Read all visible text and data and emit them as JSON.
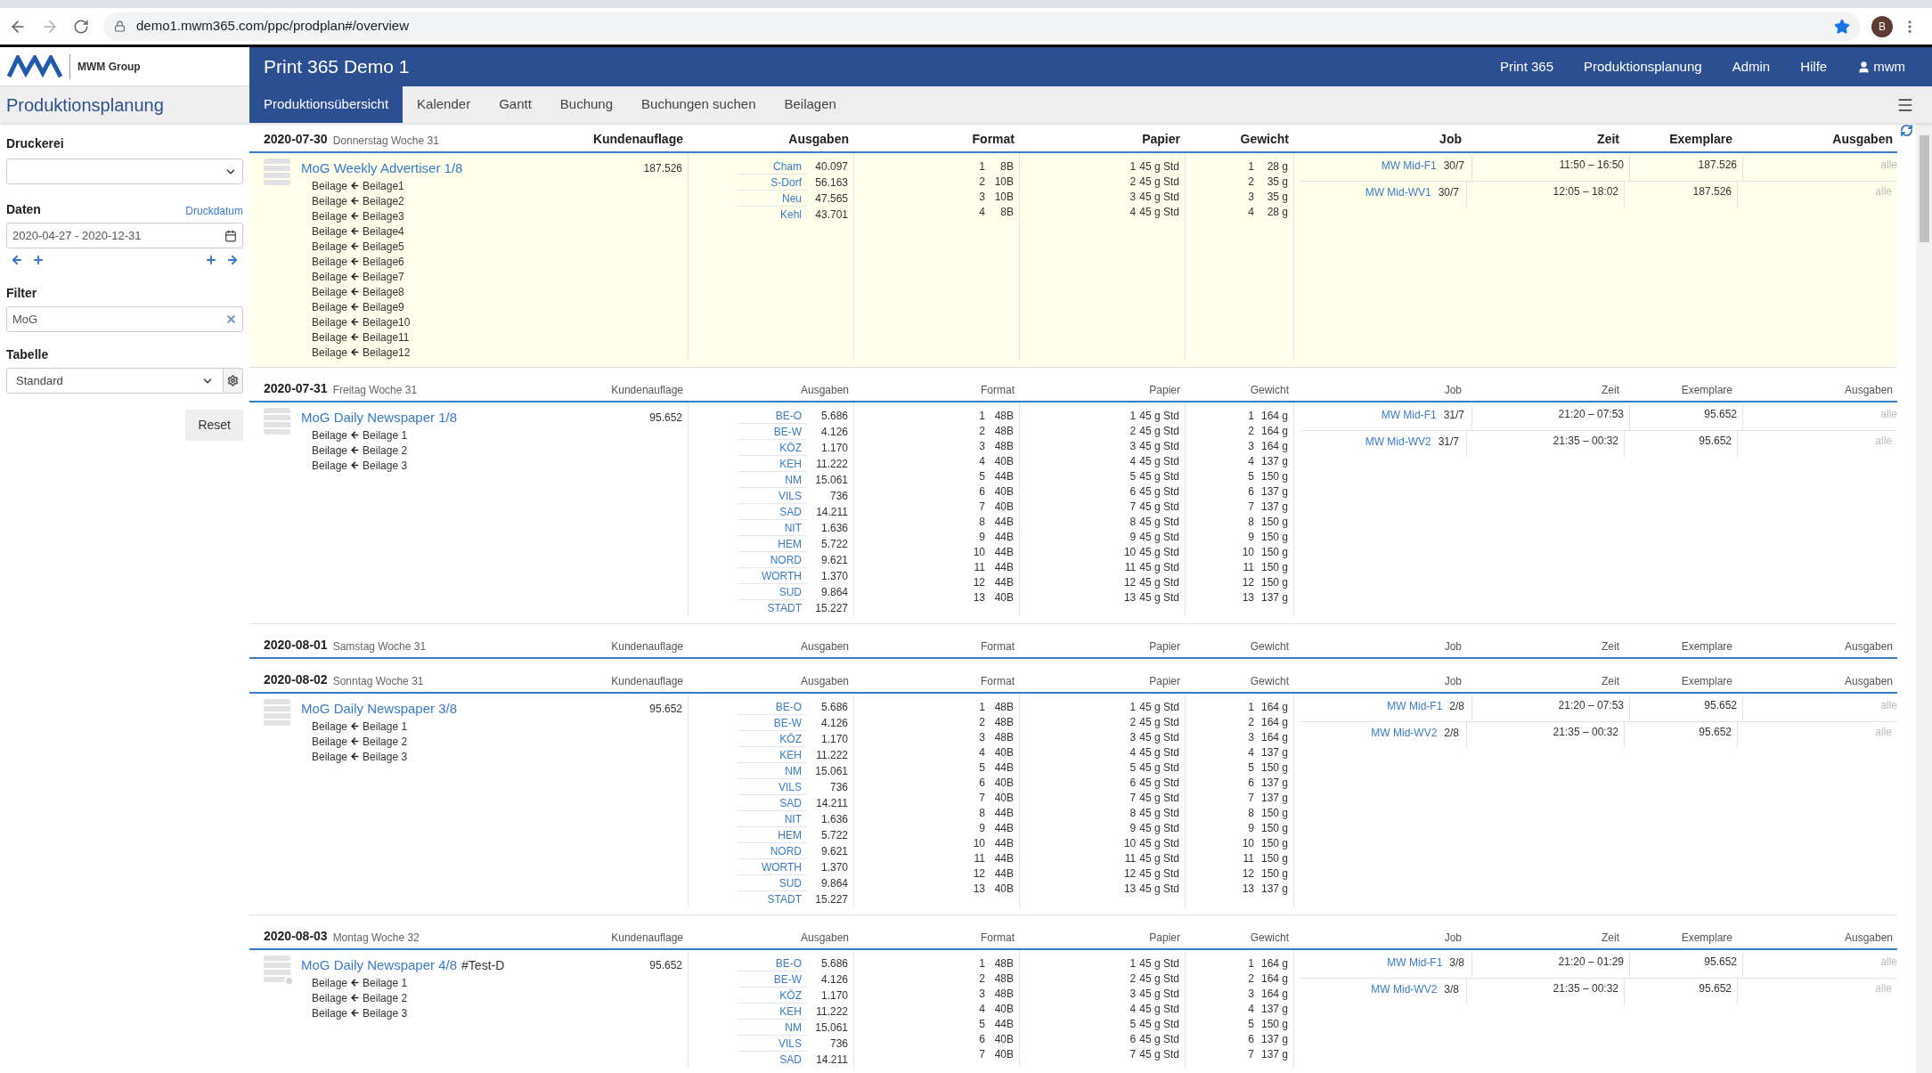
{
  "browser": {
    "url": "demo1.mwm365.com/ppc/prodplan#/overview",
    "profile": "B"
  },
  "brand": {
    "logo_text": "MWM Group",
    "app_name": "Produktionsplanung"
  },
  "header": {
    "title": "Print 365 Demo 1",
    "menu": [
      {
        "label": "Print 365",
        "kind": "link"
      },
      {
        "label": "Produktionsplanung",
        "kind": "link"
      },
      {
        "label": "Admin",
        "kind": "link"
      },
      {
        "label": "Hilfe",
        "kind": "link"
      },
      {
        "label": "mwm",
        "kind": "user"
      }
    ]
  },
  "tabs": [
    {
      "label": "Produktionsübersicht",
      "selected": true
    },
    {
      "label": "Kalender",
      "selected": false
    },
    {
      "label": "Gantt",
      "selected": false
    },
    {
      "label": "Buchung",
      "selected": false
    },
    {
      "label": "Buchungen suchen",
      "selected": false
    },
    {
      "label": "Beilagen",
      "selected": false
    }
  ],
  "sidebar": {
    "druckerei": {
      "label": "Druckerei"
    },
    "daten": {
      "label": "Daten",
      "link": "Druckdatum",
      "value": "2020-04-27 - 2020-12-31"
    },
    "filter": {
      "label": "Filter",
      "value": "MoG"
    },
    "tabelle": {
      "label": "Tabelle",
      "value": "Standard"
    },
    "reset": "Reset"
  },
  "days": [
    {
      "date": "2020-07-30",
      "weekday": "Donnerstag Woche 31",
      "highlighted": true,
      "columns": [
        "Kundenauflage",
        "Ausgaben",
        "Format",
        "Papier",
        "Gewicht",
        "Job",
        "Zeit",
        "Exemplare",
        "Ausgaben"
      ],
      "productions": [
        {
          "title": "MoG Weekly Advertiser 1/8",
          "marked": false,
          "circulation": "187.526",
          "inserts": [
            [
              "Beilage",
              "Beilage1"
            ],
            [
              "Beilage",
              "Beilage2"
            ],
            [
              "Beilage",
              "Beilage3"
            ],
            [
              "Beilage",
              "Beilage4"
            ],
            [
              "Beilage",
              "Beilage5"
            ],
            [
              "Beilage",
              "Beilage6"
            ],
            [
              "Beilage",
              "Beilage7"
            ],
            [
              "Beilage",
              "Beilage8"
            ],
            [
              "Beilage",
              "Beilage9"
            ],
            [
              "Beilage",
              "Beilage10"
            ],
            [
              "Beilage",
              "Beilage11"
            ],
            [
              "Beilage",
              "Beilage12"
            ]
          ],
          "editions": [
            [
              "Cham",
              "40.097"
            ],
            [
              "S-Dorf",
              "56.163"
            ],
            [
              "Neu",
              "47.565"
            ],
            [
              "Kehl",
              "43.701"
            ]
          ],
          "formats": [
            [
              "1",
              "8B"
            ],
            [
              "2",
              "10B"
            ],
            [
              "3",
              "10B"
            ],
            [
              "4",
              "8B"
            ]
          ],
          "papers": [
            [
              "1",
              "45 g Std"
            ],
            [
              "2",
              "45 g Std"
            ],
            [
              "3",
              "45 g Std"
            ],
            [
              "4",
              "45 g Std"
            ]
          ],
          "weights": [
            [
              "1",
              "28 g"
            ],
            [
              "2",
              "35 g"
            ],
            [
              "3",
              "35 g"
            ],
            [
              "4",
              "28 g"
            ]
          ],
          "jobs": [
            {
              "name": "MW Mid-F1",
              "date": "30/7",
              "time": "11:50 – 16:50",
              "copies": "187.526",
              "editions": "alle"
            },
            {
              "name": "MW Mid-WV1",
              "date": "30/7",
              "time": "12:05 – 18:02",
              "copies": "187.526",
              "editions": "alle"
            }
          ]
        }
      ]
    },
    {
      "date": "2020-07-31",
      "weekday": "Freitag Woche 31",
      "highlighted": false,
      "columns": [
        "Kundenauflage",
        "Ausgaben",
        "Format",
        "Papier",
        "Gewicht",
        "Job",
        "Zeit",
        "Exemplare",
        "Ausgaben"
      ],
      "productions": [
        {
          "title": "MoG Daily Newspaper 1/8",
          "marked": false,
          "circulation": "95.652",
          "inserts": [
            [
              "Beilage",
              "Beilage 1"
            ],
            [
              "Beilage",
              "Beilage 2"
            ],
            [
              "Beilage",
              "Beilage 3"
            ]
          ],
          "editions": [
            [
              "BE-O",
              "5.686"
            ],
            [
              "BE-W",
              "4.126"
            ],
            [
              "KÖZ",
              "1.170"
            ],
            [
              "KEH",
              "11.222"
            ],
            [
              "NM",
              "15.061"
            ],
            [
              "VILS",
              "736"
            ],
            [
              "SAD",
              "14.211"
            ],
            [
              "NIT",
              "1.636"
            ],
            [
              "HEM",
              "5.722"
            ],
            [
              "NORD",
              "9.621"
            ],
            [
              "WORTH",
              "1.370"
            ],
            [
              "SUD",
              "9.864"
            ],
            [
              "STADT",
              "15.227"
            ]
          ],
          "formats": [
            [
              "1",
              "48B"
            ],
            [
              "2",
              "48B"
            ],
            [
              "3",
              "48B"
            ],
            [
              "4",
              "40B"
            ],
            [
              "5",
              "44B"
            ],
            [
              "6",
              "40B"
            ],
            [
              "7",
              "40B"
            ],
            [
              "8",
              "44B"
            ],
            [
              "9",
              "44B"
            ],
            [
              "10",
              "44B"
            ],
            [
              "11",
              "44B"
            ],
            [
              "12",
              "44B"
            ],
            [
              "13",
              "40B"
            ]
          ],
          "papers": [
            [
              "1",
              "45 g Std"
            ],
            [
              "2",
              "45 g Std"
            ],
            [
              "3",
              "45 g Std"
            ],
            [
              "4",
              "45 g Std"
            ],
            [
              "5",
              "45 g Std"
            ],
            [
              "6",
              "45 g Std"
            ],
            [
              "7",
              "45 g Std"
            ],
            [
              "8",
              "45 g Std"
            ],
            [
              "9",
              "45 g Std"
            ],
            [
              "10",
              "45 g Std"
            ],
            [
              "11",
              "45 g Std"
            ],
            [
              "12",
              "45 g Std"
            ],
            [
              "13",
              "45 g Std"
            ]
          ],
          "weights": [
            [
              "1",
              "164 g"
            ],
            [
              "2",
              "164 g"
            ],
            [
              "3",
              "164 g"
            ],
            [
              "4",
              "137 g"
            ],
            [
              "5",
              "150 g"
            ],
            [
              "6",
              "137 g"
            ],
            [
              "7",
              "137 g"
            ],
            [
              "8",
              "150 g"
            ],
            [
              "9",
              "150 g"
            ],
            [
              "10",
              "150 g"
            ],
            [
              "11",
              "150 g"
            ],
            [
              "12",
              "150 g"
            ],
            [
              "13",
              "137 g"
            ]
          ],
          "jobs": [
            {
              "name": "MW Mid-F1",
              "date": "31/7",
              "time": "21:20 – 07:53",
              "copies": "95.652",
              "editions": "alle"
            },
            {
              "name": "MW Mid-WV2",
              "date": "31/7",
              "time": "21:35 – 00:32",
              "copies": "95.652",
              "editions": "alle"
            }
          ]
        }
      ]
    },
    {
      "date": "2020-08-01",
      "weekday": "Samstag Woche 31",
      "highlighted": false,
      "columns": [
        "Kundenauflage",
        "Ausgaben",
        "Format",
        "Papier",
        "Gewicht",
        "Job",
        "Zeit",
        "Exemplare",
        "Ausgaben"
      ]
    },
    {
      "date": "2020-08-02",
      "weekday": "Sonntag Woche 31",
      "highlighted": false,
      "columns": [
        "Kundenauflage",
        "Ausgaben",
        "Format",
        "Papier",
        "Gewicht",
        "Job",
        "Zeit",
        "Exemplare",
        "Ausgaben"
      ],
      "productions": [
        {
          "title": "MoG Daily Newspaper 3/8",
          "marked": false,
          "circulation": "95.652",
          "inserts": [
            [
              "Beilage",
              "Beilage 1"
            ],
            [
              "Beilage",
              "Beilage 2"
            ],
            [
              "Beilage",
              "Beilage 3"
            ]
          ],
          "editions": [
            [
              "BE-O",
              "5.686"
            ],
            [
              "BE-W",
              "4.126"
            ],
            [
              "KÖZ",
              "1.170"
            ],
            [
              "KEH",
              "11.222"
            ],
            [
              "NM",
              "15.061"
            ],
            [
              "VILS",
              "736"
            ],
            [
              "SAD",
              "14.211"
            ],
            [
              "NIT",
              "1.636"
            ],
            [
              "HEM",
              "5.722"
            ],
            [
              "NORD",
              "9.621"
            ],
            [
              "WORTH",
              "1.370"
            ],
            [
              "SUD",
              "9.864"
            ],
            [
              "STADT",
              "15.227"
            ]
          ],
          "formats": [
            [
              "1",
              "48B"
            ],
            [
              "2",
              "48B"
            ],
            [
              "3",
              "48B"
            ],
            [
              "4",
              "40B"
            ],
            [
              "5",
              "44B"
            ],
            [
              "6",
              "40B"
            ],
            [
              "7",
              "40B"
            ],
            [
              "8",
              "44B"
            ],
            [
              "9",
              "44B"
            ],
            [
              "10",
              "44B"
            ],
            [
              "11",
              "44B"
            ],
            [
              "12",
              "44B"
            ],
            [
              "13",
              "40B"
            ]
          ],
          "papers": [
            [
              "1",
              "45 g Std"
            ],
            [
              "2",
              "45 g Std"
            ],
            [
              "3",
              "45 g Std"
            ],
            [
              "4",
              "45 g Std"
            ],
            [
              "5",
              "45 g Std"
            ],
            [
              "6",
              "45 g Std"
            ],
            [
              "7",
              "45 g Std"
            ],
            [
              "8",
              "45 g Std"
            ],
            [
              "9",
              "45 g Std"
            ],
            [
              "10",
              "45 g Std"
            ],
            [
              "11",
              "45 g Std"
            ],
            [
              "12",
              "45 g Std"
            ],
            [
              "13",
              "45 g Std"
            ]
          ],
          "weights": [
            [
              "1",
              "164 g"
            ],
            [
              "2",
              "164 g"
            ],
            [
              "3",
              "164 g"
            ],
            [
              "4",
              "137 g"
            ],
            [
              "5",
              "150 g"
            ],
            [
              "6",
              "137 g"
            ],
            [
              "7",
              "137 g"
            ],
            [
              "8",
              "150 g"
            ],
            [
              "9",
              "150 g"
            ],
            [
              "10",
              "150 g"
            ],
            [
              "11",
              "150 g"
            ],
            [
              "12",
              "150 g"
            ],
            [
              "13",
              "137 g"
            ]
          ],
          "jobs": [
            {
              "name": "MW Mid-F1",
              "date": "2/8",
              "time": "21:20 – 07:53",
              "copies": "95.652",
              "editions": "alle"
            },
            {
              "name": "MW Mid-WV2",
              "date": "2/8",
              "time": "21:35 – 00:32",
              "copies": "95.652",
              "editions": "alle"
            }
          ]
        }
      ]
    },
    {
      "date": "2020-08-03",
      "weekday": "Montag Woche 32",
      "highlighted": false,
      "columns": [
        "Kundenauflage",
        "Ausgaben",
        "Format",
        "Papier",
        "Gewicht",
        "Job",
        "Zeit",
        "Exemplare",
        "Ausgaben"
      ],
      "productions": [
        {
          "title": "MoG Daily Newspaper 4/8",
          "tag": "#Test-D",
          "marked": true,
          "circulation": "95.652",
          "inserts": [
            [
              "Beilage",
              "Beilage 1"
            ],
            [
              "Beilage",
              "Beilage 2"
            ],
            [
              "Beilage",
              "Beilage 3"
            ]
          ],
          "editions": [
            [
              "BE-O",
              "5.686"
            ],
            [
              "BE-W",
              "4.126"
            ],
            [
              "KÖZ",
              "1.170"
            ],
            [
              "KEH",
              "11.222"
            ],
            [
              "NM",
              "15.061"
            ],
            [
              "VILS",
              "736"
            ],
            [
              "SAD",
              "14.211"
            ]
          ],
          "formats": [
            [
              "1",
              "48B"
            ],
            [
              "2",
              "48B"
            ],
            [
              "3",
              "48B"
            ],
            [
              "4",
              "40B"
            ],
            [
              "5",
              "44B"
            ],
            [
              "6",
              "40B"
            ],
            [
              "7",
              "40B"
            ]
          ],
          "papers": [
            [
              "1",
              "45 g Std"
            ],
            [
              "2",
              "45 g Std"
            ],
            [
              "3",
              "45 g Std"
            ],
            [
              "4",
              "45 g Std"
            ],
            [
              "5",
              "45 g Std"
            ],
            [
              "6",
              "45 g Std"
            ],
            [
              "7",
              "45 g Std"
            ]
          ],
          "weights": [
            [
              "1",
              "164 g"
            ],
            [
              "2",
              "164 g"
            ],
            [
              "3",
              "164 g"
            ],
            [
              "4",
              "137 g"
            ],
            [
              "5",
              "150 g"
            ],
            [
              "6",
              "137 g"
            ],
            [
              "7",
              "137 g"
            ]
          ],
          "jobs": [
            {
              "name": "MW Mid-F1",
              "date": "3/8",
              "time": "21:20 – 01:29",
              "copies": "95.652",
              "editions": "alle"
            },
            {
              "name": "MW Mid-WV2",
              "date": "3/8",
              "time": "21:35 – 00:32",
              "copies": "95.652",
              "editions": "alle"
            }
          ]
        }
      ]
    }
  ]
}
